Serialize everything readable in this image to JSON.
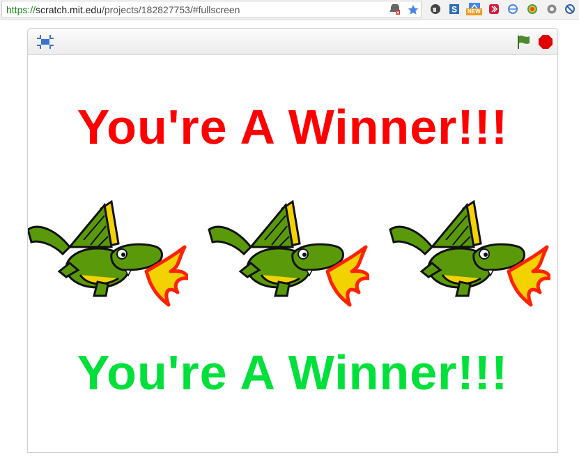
{
  "browser": {
    "url_scheme": "https://",
    "url_host": "scratch.mit.edu",
    "url_path": "/projects/182827753/#fullscreen",
    "icons": [
      "site-settings-icon",
      "bookmark-star-icon",
      "extension-evernote-icon",
      "extension-s-icon",
      "extension-new-icon",
      "extension-red-icon",
      "extension-sync-icon",
      "extension-color-icon",
      "extension-gear-icon",
      "extension-block-icon"
    ],
    "badge_new": "NEW"
  },
  "player": {
    "controls": {
      "fullscreen_icon": "exit-fullscreen-icon",
      "green_flag_icon": "green-flag-icon",
      "stop_icon": "stop-icon"
    },
    "stage": {
      "top_text": "You're A Winner!!!",
      "bottom_text": "You're A Winner!!!",
      "top_color": "#ff0000",
      "bottom_color": "#00e03a",
      "sprites": [
        "dragon",
        "dragon",
        "dragon"
      ]
    }
  }
}
